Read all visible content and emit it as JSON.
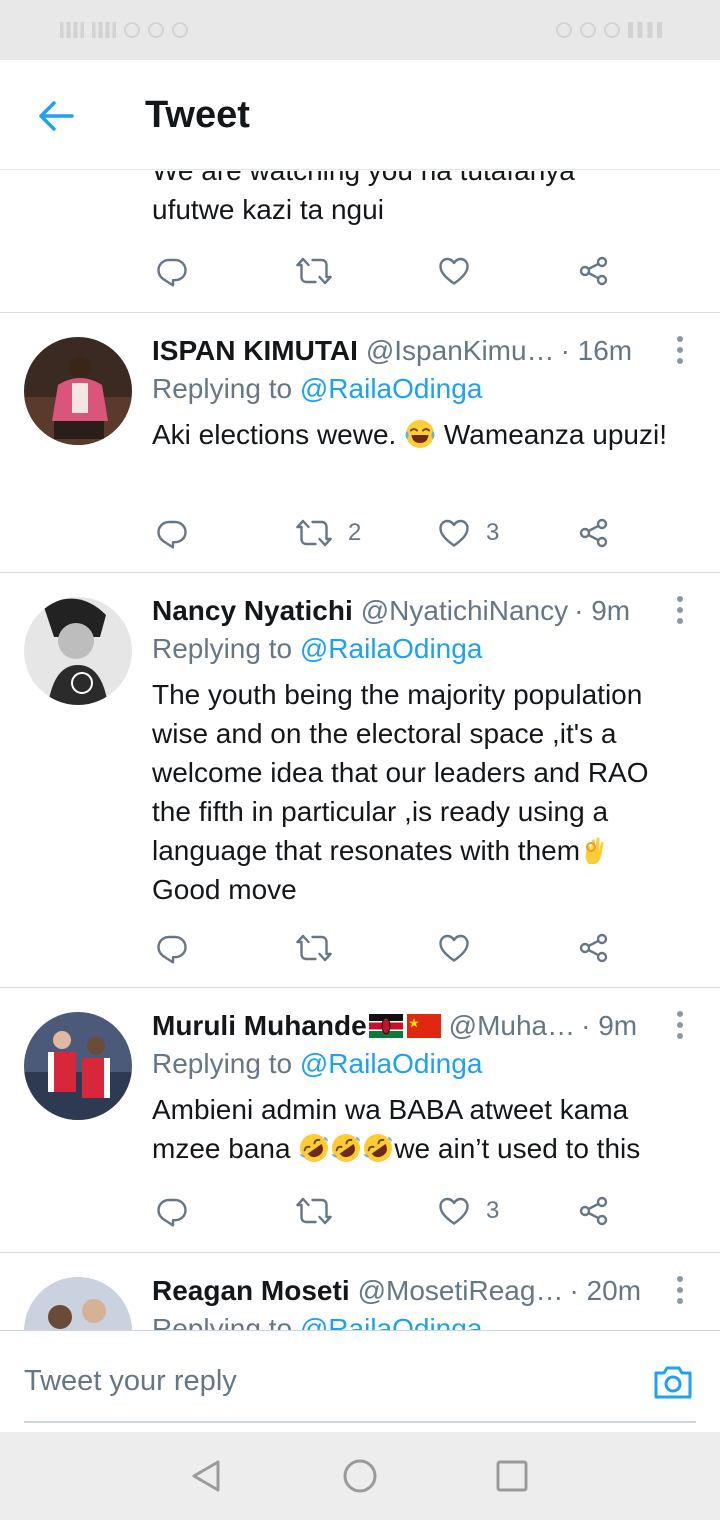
{
  "header": {
    "title": "Tweet"
  },
  "partial_tweet": {
    "text_line1": "We are watching you na tutafanya",
    "text_line2": "ufutwe kazi ta ngui"
  },
  "tweets": [
    {
      "name": "ISPAN KIMUTAI",
      "handle": "@IspanKimu…",
      "time": "· 16m",
      "replying_prefix": "Replying to",
      "replying_to": "@RailaOdinga",
      "text_a": "Aki elections wewe.",
      "text_b": "Wameanza upuzi!",
      "retweets": "2",
      "likes": "3"
    },
    {
      "name": "Nancy Nyatichi",
      "handle": "@NyatichiNancy",
      "time": "· 9m",
      "replying_prefix": "Replying to",
      "replying_to": "@RailaOdinga",
      "text_a": "The youth being the majority population wise and on the electoral space ,it's a welcome idea that our leaders and RAO the fifth in particular ,is ready using a language that resonates with them",
      "text_b": "Good move",
      "retweets": "",
      "likes": ""
    },
    {
      "name": "Muruli Muhande",
      "handle": "@Muha…",
      "time": "· 9m",
      "replying_prefix": "Replying to",
      "replying_to": "@RailaOdinga",
      "text_a": "Ambieni admin wa BABA atweet kama mzee bana",
      "text_b": "we ain’t used to this",
      "retweets": "",
      "likes": "3"
    },
    {
      "name": "Reagan Moseti",
      "handle": "@MosetiReag…",
      "time": "· 20m",
      "replying_prefix": "Replying to",
      "replying_to": "@RailaOdinga"
    }
  ],
  "composer": {
    "placeholder": "Tweet your reply"
  },
  "colors": {
    "accent": "#1da1f2",
    "text": "#14171a",
    "secondary": "#657786"
  },
  "icons": [
    "back-arrow-icon",
    "reply-icon",
    "retweet-icon",
    "like-icon",
    "share-icon",
    "more-icon",
    "camera-icon",
    "nav-back-icon",
    "nav-home-icon",
    "nav-recents-icon"
  ]
}
